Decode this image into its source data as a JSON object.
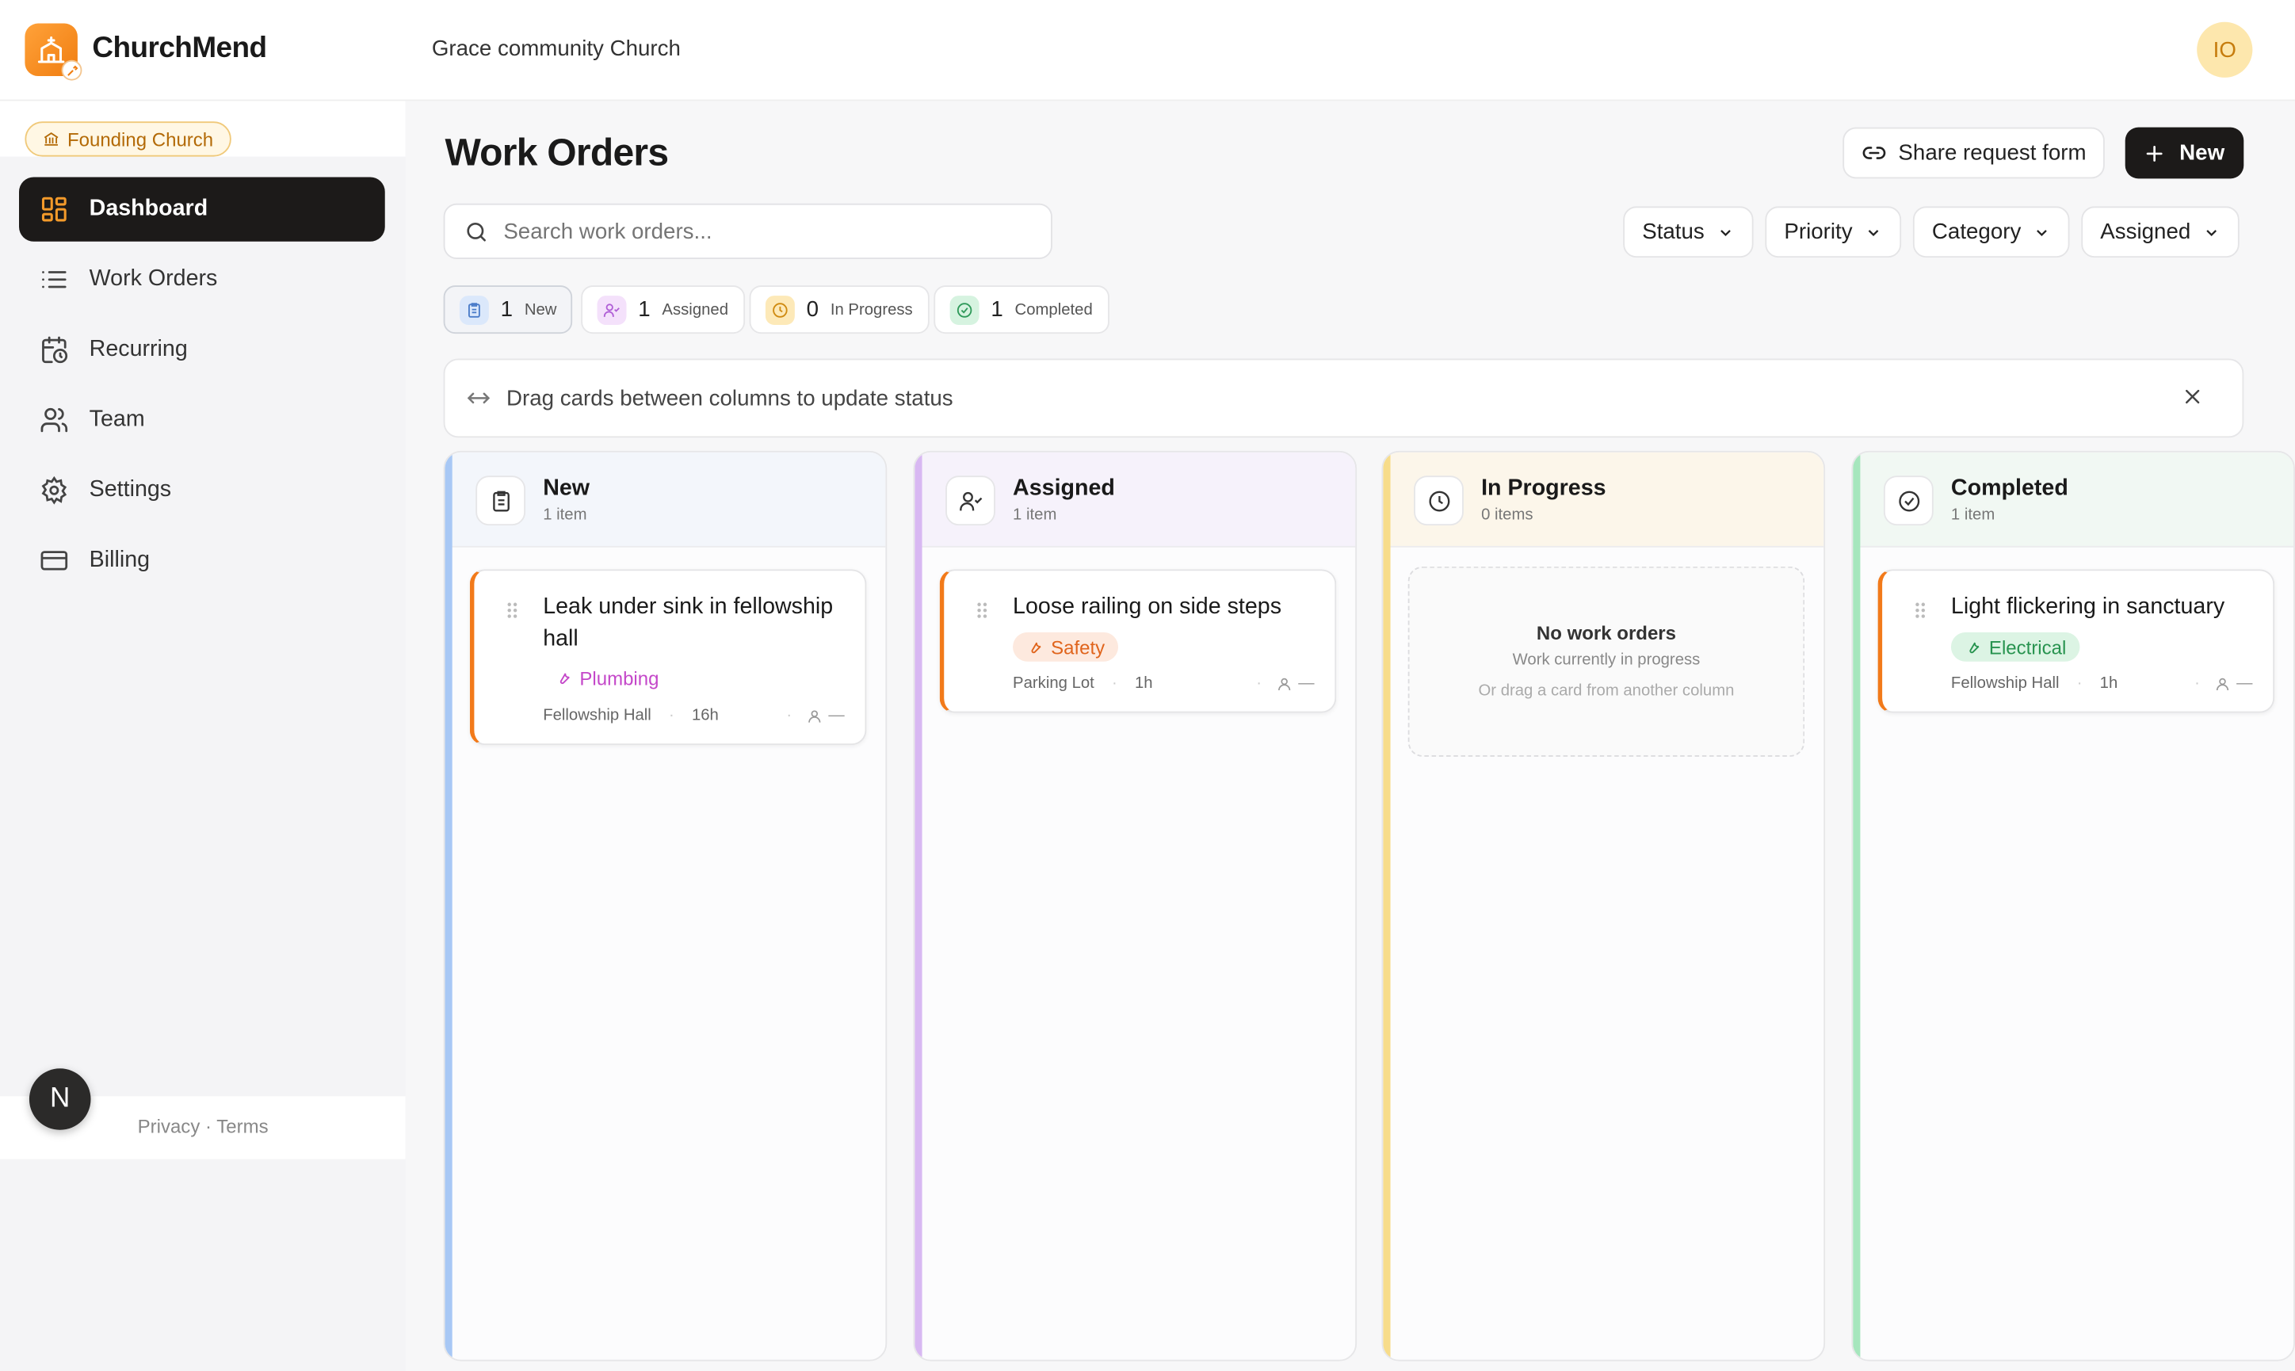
{
  "app": {
    "brand": "ChurchMend",
    "church_name": "Grace community Church",
    "user_initials": "IO"
  },
  "sidebar": {
    "badge": "Founding Church",
    "items": [
      {
        "label": "Dashboard",
        "icon": "grid-icon",
        "active": true
      },
      {
        "label": "Work Orders",
        "icon": "list-icon"
      },
      {
        "label": "Recurring",
        "icon": "calendar-clock-icon"
      },
      {
        "label": "Team",
        "icon": "users-icon"
      },
      {
        "label": "Settings",
        "icon": "gear-icon"
      },
      {
        "label": "Billing",
        "icon": "credit-card-icon"
      }
    ],
    "footer": "Privacy · Terms",
    "n_badge": "N"
  },
  "header": {
    "title": "Work Orders",
    "share_label": "Share request form",
    "new_label": "New"
  },
  "search": {
    "placeholder": "Search work orders..."
  },
  "filters": [
    "Status",
    "Priority",
    "Category",
    "Assigned"
  ],
  "stats": [
    {
      "count": "1",
      "label": "New"
    },
    {
      "count": "1",
      "label": "Assigned"
    },
    {
      "count": "0",
      "label": "In Progress"
    },
    {
      "count": "1",
      "label": "Completed"
    }
  ],
  "hint": "Drag cards between columns to update status",
  "columns": [
    {
      "title": "New",
      "count_label": "1 item",
      "card": {
        "title": "Leak under sink in fellowship hall",
        "tag": "Plumbing",
        "location": "Fellowship Hall",
        "age": "16h",
        "assignee": "—"
      }
    },
    {
      "title": "Assigned",
      "count_label": "1 item",
      "card": {
        "title": "Loose railing on side steps",
        "tag": "Safety",
        "location": "Parking Lot",
        "age": "1h",
        "assignee": "—"
      }
    },
    {
      "title": "In Progress",
      "count_label": "0 items",
      "empty": {
        "title": "No work orders",
        "subtitle": "Work currently in progress",
        "hint": "Or drag a card from another column"
      }
    },
    {
      "title": "Completed",
      "count_label": "1 item",
      "card": {
        "title": "Light flickering in sanctuary",
        "tag": "Electrical",
        "location": "Fellowship Hall",
        "age": "1h",
        "assignee": "—"
      }
    }
  ],
  "colors": {
    "accent_dark": "#1c1a19",
    "brand_orange": "#f07d10",
    "new_column": "#a8c8f5",
    "assigned_column": "#d8b8f2",
    "in_progress_column": "#f7dc8a",
    "completed_column": "#a6e6bd"
  }
}
